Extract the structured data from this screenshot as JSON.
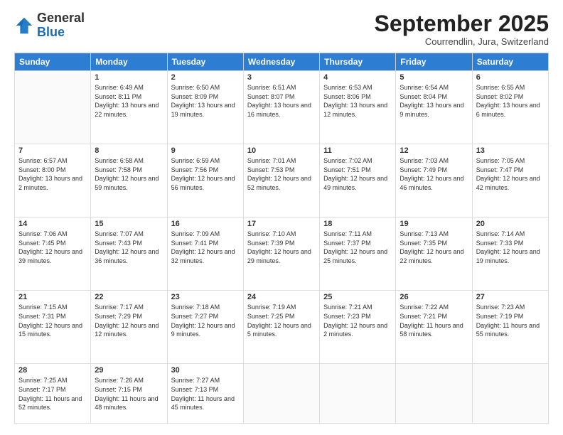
{
  "logo": {
    "general": "General",
    "blue": "Blue"
  },
  "header": {
    "month": "September 2025",
    "location": "Courrendlin, Jura, Switzerland"
  },
  "weekdays": [
    "Sunday",
    "Monday",
    "Tuesday",
    "Wednesday",
    "Thursday",
    "Friday",
    "Saturday"
  ],
  "weeks": [
    [
      {
        "day": "",
        "sunrise": "",
        "sunset": "",
        "daylight": ""
      },
      {
        "day": "1",
        "sunrise": "Sunrise: 6:49 AM",
        "sunset": "Sunset: 8:11 PM",
        "daylight": "Daylight: 13 hours and 22 minutes."
      },
      {
        "day": "2",
        "sunrise": "Sunrise: 6:50 AM",
        "sunset": "Sunset: 8:09 PM",
        "daylight": "Daylight: 13 hours and 19 minutes."
      },
      {
        "day": "3",
        "sunrise": "Sunrise: 6:51 AM",
        "sunset": "Sunset: 8:07 PM",
        "daylight": "Daylight: 13 hours and 16 minutes."
      },
      {
        "day": "4",
        "sunrise": "Sunrise: 6:53 AM",
        "sunset": "Sunset: 8:06 PM",
        "daylight": "Daylight: 13 hours and 12 minutes."
      },
      {
        "day": "5",
        "sunrise": "Sunrise: 6:54 AM",
        "sunset": "Sunset: 8:04 PM",
        "daylight": "Daylight: 13 hours and 9 minutes."
      },
      {
        "day": "6",
        "sunrise": "Sunrise: 6:55 AM",
        "sunset": "Sunset: 8:02 PM",
        "daylight": "Daylight: 13 hours and 6 minutes."
      }
    ],
    [
      {
        "day": "7",
        "sunrise": "Sunrise: 6:57 AM",
        "sunset": "Sunset: 8:00 PM",
        "daylight": "Daylight: 13 hours and 2 minutes."
      },
      {
        "day": "8",
        "sunrise": "Sunrise: 6:58 AM",
        "sunset": "Sunset: 7:58 PM",
        "daylight": "Daylight: 12 hours and 59 minutes."
      },
      {
        "day": "9",
        "sunrise": "Sunrise: 6:59 AM",
        "sunset": "Sunset: 7:56 PM",
        "daylight": "Daylight: 12 hours and 56 minutes."
      },
      {
        "day": "10",
        "sunrise": "Sunrise: 7:01 AM",
        "sunset": "Sunset: 7:53 PM",
        "daylight": "Daylight: 12 hours and 52 minutes."
      },
      {
        "day": "11",
        "sunrise": "Sunrise: 7:02 AM",
        "sunset": "Sunset: 7:51 PM",
        "daylight": "Daylight: 12 hours and 49 minutes."
      },
      {
        "day": "12",
        "sunrise": "Sunrise: 7:03 AM",
        "sunset": "Sunset: 7:49 PM",
        "daylight": "Daylight: 12 hours and 46 minutes."
      },
      {
        "day": "13",
        "sunrise": "Sunrise: 7:05 AM",
        "sunset": "Sunset: 7:47 PM",
        "daylight": "Daylight: 12 hours and 42 minutes."
      }
    ],
    [
      {
        "day": "14",
        "sunrise": "Sunrise: 7:06 AM",
        "sunset": "Sunset: 7:45 PM",
        "daylight": "Daylight: 12 hours and 39 minutes."
      },
      {
        "day": "15",
        "sunrise": "Sunrise: 7:07 AM",
        "sunset": "Sunset: 7:43 PM",
        "daylight": "Daylight: 12 hours and 36 minutes."
      },
      {
        "day": "16",
        "sunrise": "Sunrise: 7:09 AM",
        "sunset": "Sunset: 7:41 PM",
        "daylight": "Daylight: 12 hours and 32 minutes."
      },
      {
        "day": "17",
        "sunrise": "Sunrise: 7:10 AM",
        "sunset": "Sunset: 7:39 PM",
        "daylight": "Daylight: 12 hours and 29 minutes."
      },
      {
        "day": "18",
        "sunrise": "Sunrise: 7:11 AM",
        "sunset": "Sunset: 7:37 PM",
        "daylight": "Daylight: 12 hours and 25 minutes."
      },
      {
        "day": "19",
        "sunrise": "Sunrise: 7:13 AM",
        "sunset": "Sunset: 7:35 PM",
        "daylight": "Daylight: 12 hours and 22 minutes."
      },
      {
        "day": "20",
        "sunrise": "Sunrise: 7:14 AM",
        "sunset": "Sunset: 7:33 PM",
        "daylight": "Daylight: 12 hours and 19 minutes."
      }
    ],
    [
      {
        "day": "21",
        "sunrise": "Sunrise: 7:15 AM",
        "sunset": "Sunset: 7:31 PM",
        "daylight": "Daylight: 12 hours and 15 minutes."
      },
      {
        "day": "22",
        "sunrise": "Sunrise: 7:17 AM",
        "sunset": "Sunset: 7:29 PM",
        "daylight": "Daylight: 12 hours and 12 minutes."
      },
      {
        "day": "23",
        "sunrise": "Sunrise: 7:18 AM",
        "sunset": "Sunset: 7:27 PM",
        "daylight": "Daylight: 12 hours and 9 minutes."
      },
      {
        "day": "24",
        "sunrise": "Sunrise: 7:19 AM",
        "sunset": "Sunset: 7:25 PM",
        "daylight": "Daylight: 12 hours and 5 minutes."
      },
      {
        "day": "25",
        "sunrise": "Sunrise: 7:21 AM",
        "sunset": "Sunset: 7:23 PM",
        "daylight": "Daylight: 12 hours and 2 minutes."
      },
      {
        "day": "26",
        "sunrise": "Sunrise: 7:22 AM",
        "sunset": "Sunset: 7:21 PM",
        "daylight": "Daylight: 11 hours and 58 minutes."
      },
      {
        "day": "27",
        "sunrise": "Sunrise: 7:23 AM",
        "sunset": "Sunset: 7:19 PM",
        "daylight": "Daylight: 11 hours and 55 minutes."
      }
    ],
    [
      {
        "day": "28",
        "sunrise": "Sunrise: 7:25 AM",
        "sunset": "Sunset: 7:17 PM",
        "daylight": "Daylight: 11 hours and 52 minutes."
      },
      {
        "day": "29",
        "sunrise": "Sunrise: 7:26 AM",
        "sunset": "Sunset: 7:15 PM",
        "daylight": "Daylight: 11 hours and 48 minutes."
      },
      {
        "day": "30",
        "sunrise": "Sunrise: 7:27 AM",
        "sunset": "Sunset: 7:13 PM",
        "daylight": "Daylight: 11 hours and 45 minutes."
      },
      {
        "day": "",
        "sunrise": "",
        "sunset": "",
        "daylight": ""
      },
      {
        "day": "",
        "sunrise": "",
        "sunset": "",
        "daylight": ""
      },
      {
        "day": "",
        "sunrise": "",
        "sunset": "",
        "daylight": ""
      },
      {
        "day": "",
        "sunrise": "",
        "sunset": "",
        "daylight": ""
      }
    ]
  ]
}
